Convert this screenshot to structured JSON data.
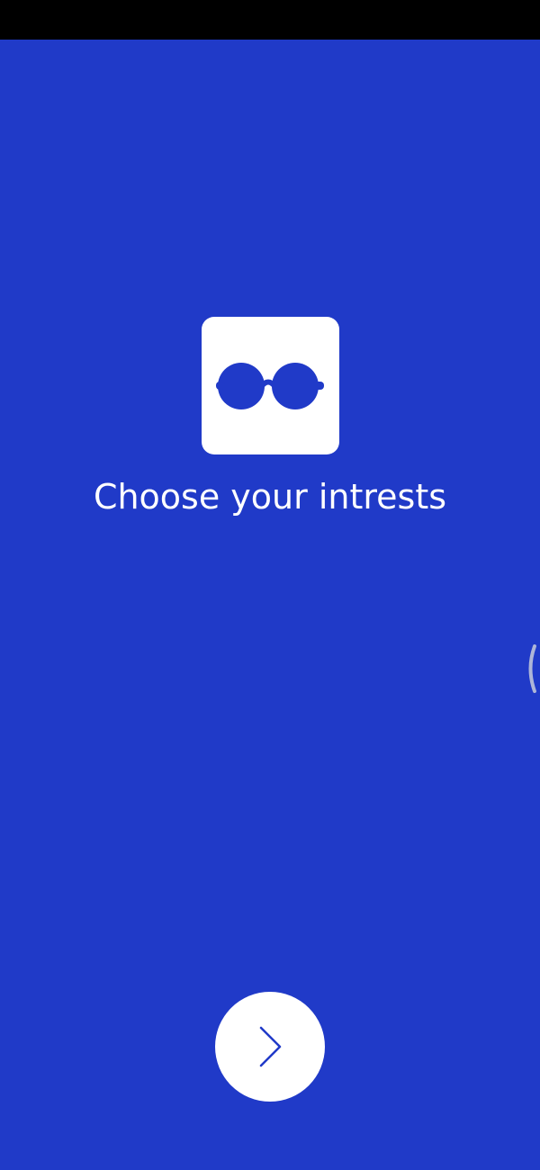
{
  "theme": {
    "background": "#203AC8",
    "status_bar": "#000000",
    "tile": "#FFFFFF",
    "accent": "#203AC8"
  },
  "onboarding": {
    "logo_icon": "glasses-icon",
    "title": "Choose your intrests",
    "next_icon": "chevron-right-icon"
  }
}
